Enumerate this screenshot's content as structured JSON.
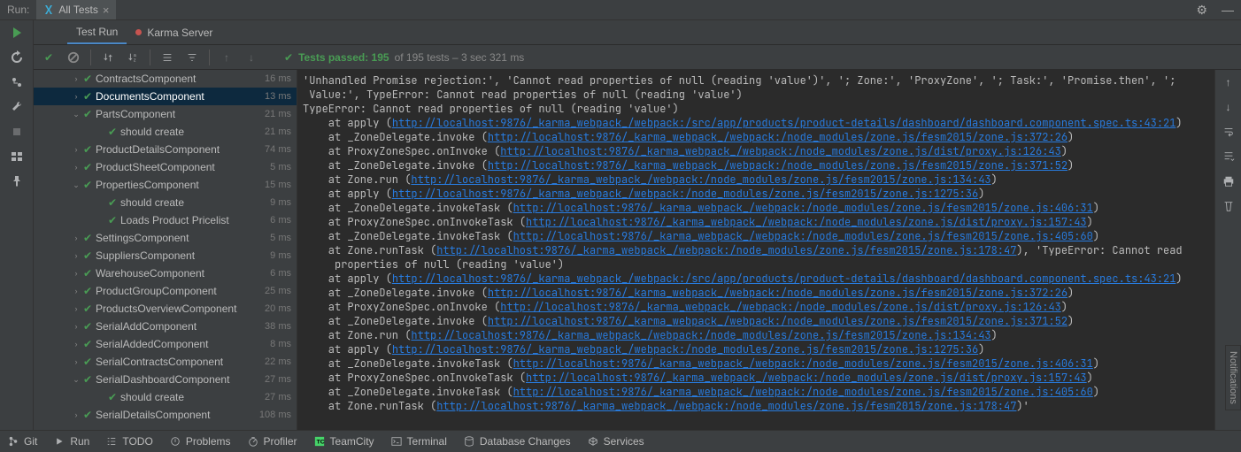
{
  "tabBar": {
    "runLabel": "Run:",
    "tabTitle": "All Tests"
  },
  "subTabs": {
    "testRun": "Test Run",
    "karmaServer": "Karma Server"
  },
  "summary": {
    "passedLabel": "Tests passed: 195",
    "rest": " of 195 tests – 3 sec 321 ms"
  },
  "tree": [
    {
      "indent": 3,
      "chevron": "right",
      "status": "pass",
      "label": "ContractsComponent",
      "time": "16 ms"
    },
    {
      "indent": 3,
      "chevron": "right",
      "status": "pass",
      "label": "DocumentsComponent",
      "time": "13 ms",
      "selected": true
    },
    {
      "indent": 3,
      "chevron": "down",
      "status": "pass",
      "label": "PartsComponent",
      "time": "21 ms"
    },
    {
      "indent": 5,
      "chevron": "",
      "status": "pass",
      "label": "should create",
      "time": "21 ms"
    },
    {
      "indent": 3,
      "chevron": "right",
      "status": "pass",
      "label": "ProductDetailsComponent",
      "time": "74 ms"
    },
    {
      "indent": 3,
      "chevron": "right",
      "status": "pass",
      "label": "ProductSheetComponent",
      "time": "5 ms"
    },
    {
      "indent": 3,
      "chevron": "down",
      "status": "pass",
      "label": "PropertiesComponent",
      "time": "15 ms"
    },
    {
      "indent": 5,
      "chevron": "",
      "status": "pass",
      "label": "should create",
      "time": "9 ms"
    },
    {
      "indent": 5,
      "chevron": "",
      "status": "pass",
      "label": "Loads Product Pricelist",
      "time": "6 ms"
    },
    {
      "indent": 3,
      "chevron": "right",
      "status": "pass",
      "label": "SettingsComponent",
      "time": "5 ms"
    },
    {
      "indent": 3,
      "chevron": "right",
      "status": "pass",
      "label": "SuppliersComponent",
      "time": "9 ms"
    },
    {
      "indent": 3,
      "chevron": "right",
      "status": "pass",
      "label": "WarehouseComponent",
      "time": "6 ms"
    },
    {
      "indent": 3,
      "chevron": "right",
      "status": "pass",
      "label": "ProductGroupComponent",
      "time": "25 ms"
    },
    {
      "indent": 3,
      "chevron": "right",
      "status": "pass",
      "label": "ProductsOverviewComponent",
      "time": "20 ms"
    },
    {
      "indent": 3,
      "chevron": "right",
      "status": "pass",
      "label": "SerialAddComponent",
      "time": "38 ms"
    },
    {
      "indent": 3,
      "chevron": "right",
      "status": "pass",
      "label": "SerialAddedComponent",
      "time": "8 ms"
    },
    {
      "indent": 3,
      "chevron": "right",
      "status": "pass",
      "label": "SerialContractsComponent",
      "time": "22 ms"
    },
    {
      "indent": 3,
      "chevron": "down",
      "status": "pass",
      "label": "SerialDashboardComponent",
      "time": "27 ms"
    },
    {
      "indent": 5,
      "chevron": "",
      "status": "pass",
      "label": "should create",
      "time": "27 ms"
    },
    {
      "indent": 3,
      "chevron": "right",
      "status": "pass",
      "label": "SerialDetailsComponent",
      "time": "108 ms"
    }
  ],
  "console": {
    "lines": [
      {
        "t": "'Unhandled Promise rejection:', 'Cannot read properties of null (reading 'value')', '; Zone:', 'ProxyZone', '; Task:', 'Promise.then', ';"
      },
      {
        "t": " Value:', TypeError: Cannot read properties of null (reading 'value')"
      },
      {
        "t": "TypeError: Cannot read properties of null (reading 'value')"
      },
      {
        "t": "    at apply (",
        "link": "http://localhost:9876/_karma_webpack_/webpack:/src/app/products/product-details/dashboard/dashboard.component.spec.ts:43:21",
        "after": ")"
      },
      {
        "t": "    at _ZoneDelegate.invoke (",
        "link": "http://localhost:9876/_karma_webpack_/webpack:/node_modules/zone.js/fesm2015/zone.js:372:26",
        "after": ")"
      },
      {
        "t": "    at ProxyZoneSpec.onInvoke (",
        "link": "http://localhost:9876/_karma_webpack_/webpack:/node_modules/zone.js/dist/proxy.js:126:43",
        "after": ")"
      },
      {
        "t": "    at _ZoneDelegate.invoke (",
        "link": "http://localhost:9876/_karma_webpack_/webpack:/node_modules/zone.js/fesm2015/zone.js:371:52",
        "after": ")"
      },
      {
        "t": "    at Zone.run (",
        "link": "http://localhost:9876/_karma_webpack_/webpack:/node_modules/zone.js/fesm2015/zone.js:134:43",
        "after": ")"
      },
      {
        "t": "    at apply (",
        "link": "http://localhost:9876/_karma_webpack_/webpack:/node_modules/zone.js/fesm2015/zone.js:1275:36",
        "after": ")"
      },
      {
        "t": "    at _ZoneDelegate.invokeTask (",
        "link": "http://localhost:9876/_karma_webpack_/webpack:/node_modules/zone.js/fesm2015/zone.js:406:31",
        "after": ")"
      },
      {
        "t": "    at ProxyZoneSpec.onInvokeTask (",
        "link": "http://localhost:9876/_karma_webpack_/webpack:/node_modules/zone.js/dist/proxy.js:157:43",
        "after": ")"
      },
      {
        "t": "    at _ZoneDelegate.invokeTask (",
        "link": "http://localhost:9876/_karma_webpack_/webpack:/node_modules/zone.js/fesm2015/zone.js:405:60",
        "after": ")"
      },
      {
        "t": "    at Zone.runTask (",
        "link": "http://localhost:9876/_karma_webpack_/webpack:/node_modules/zone.js/fesm2015/zone.js:178:47",
        "after": "), 'TypeError: Cannot read"
      },
      {
        "t": "     properties of null (reading 'value')"
      },
      {
        "t": "    at apply (",
        "link": "http://localhost:9876/_karma_webpack_/webpack:/src/app/products/product-details/dashboard/dashboard.component.spec.ts:43:21",
        "after": ")"
      },
      {
        "t": "    at _ZoneDelegate.invoke (",
        "link": "http://localhost:9876/_karma_webpack_/webpack:/node_modules/zone.js/fesm2015/zone.js:372:26",
        "after": ")"
      },
      {
        "t": "    at ProxyZoneSpec.onInvoke (",
        "link": "http://localhost:9876/_karma_webpack_/webpack:/node_modules/zone.js/dist/proxy.js:126:43",
        "after": ")"
      },
      {
        "t": "    at _ZoneDelegate.invoke (",
        "link": "http://localhost:9876/_karma_webpack_/webpack:/node_modules/zone.js/fesm2015/zone.js:371:52",
        "after": ")"
      },
      {
        "t": "    at Zone.run (",
        "link": "http://localhost:9876/_karma_webpack_/webpack:/node_modules/zone.js/fesm2015/zone.js:134:43",
        "after": ")"
      },
      {
        "t": "    at apply (",
        "link": "http://localhost:9876/_karma_webpack_/webpack:/node_modules/zone.js/fesm2015/zone.js:1275:36",
        "after": ")"
      },
      {
        "t": "    at _ZoneDelegate.invokeTask (",
        "link": "http://localhost:9876/_karma_webpack_/webpack:/node_modules/zone.js/fesm2015/zone.js:406:31",
        "after": ")"
      },
      {
        "t": "    at ProxyZoneSpec.onInvokeTask (",
        "link": "http://localhost:9876/_karma_webpack_/webpack:/node_modules/zone.js/dist/proxy.js:157:43",
        "after": ")"
      },
      {
        "t": "    at _ZoneDelegate.invokeTask (",
        "link": "http://localhost:9876/_karma_webpack_/webpack:/node_modules/zone.js/fesm2015/zone.js:405:60",
        "after": ")"
      },
      {
        "t": "    at Zone.runTask (",
        "link": "http://localhost:9876/_karma_webpack_/webpack:/node_modules/zone.js/fesm2015/zone.js:178:47",
        "after": ")'"
      }
    ]
  },
  "statusBar": {
    "git": "Git",
    "run": "Run",
    "todo": "TODO",
    "problems": "Problems",
    "profiler": "Profiler",
    "teamcity": "TeamCity",
    "terminal": "Terminal",
    "db": "Database Changes",
    "services": "Services"
  },
  "notifications": "Notifications"
}
